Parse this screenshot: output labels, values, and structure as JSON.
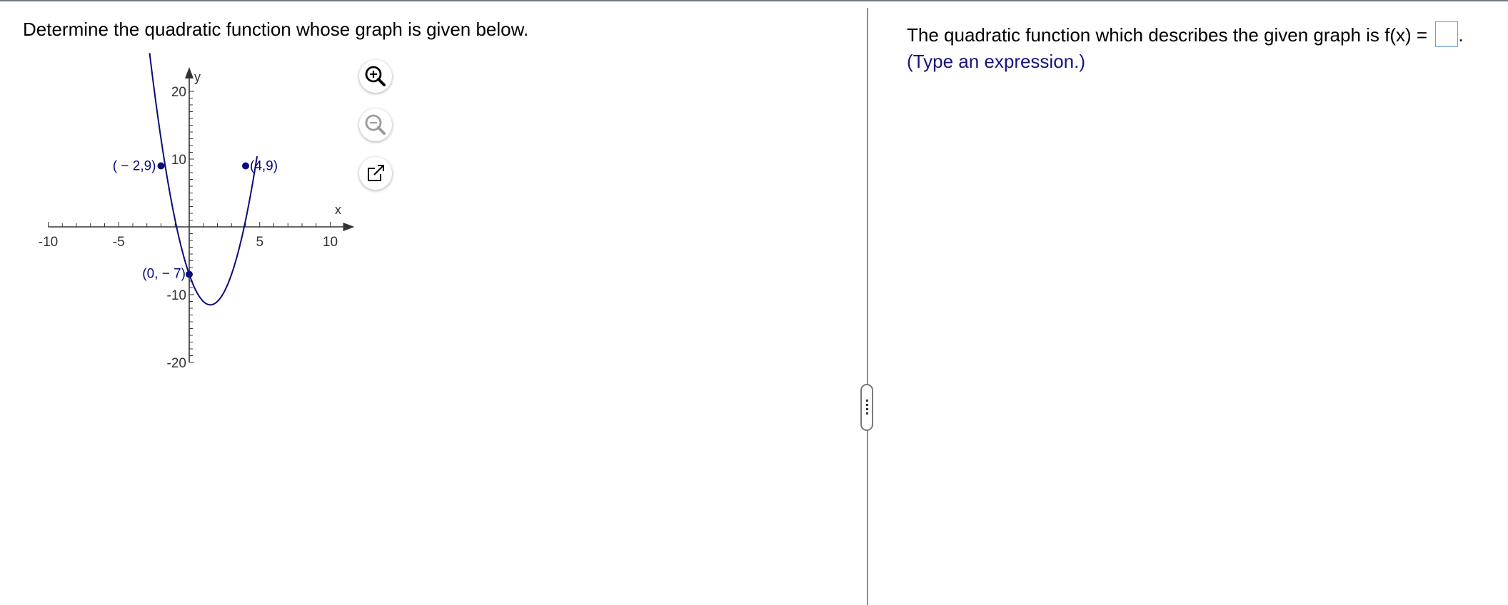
{
  "question": {
    "prompt": "Determine the quadratic function whose graph is given below."
  },
  "graph": {
    "axis_x_label": "x",
    "axis_y_label": "y",
    "x_tick_labels": [
      {
        "value": -10,
        "text": "-10"
      },
      {
        "value": -5,
        "text": "-5"
      },
      {
        "value": 5,
        "text": "5"
      },
      {
        "value": 10,
        "text": "10"
      }
    ],
    "y_tick_labels": [
      {
        "value": 20,
        "text": "20"
      },
      {
        "value": 10,
        "text": "10"
      },
      {
        "value": -10,
        "text": "-10"
      },
      {
        "value": -20,
        "text": "-20"
      }
    ],
    "curve_color": "#0b0b7a",
    "axis_color": "#333333"
  },
  "chart_data": {
    "type": "line",
    "xlim": [
      -10,
      10
    ],
    "ylim": [
      -20,
      20
    ],
    "x_ticks": [
      -10,
      -5,
      5,
      10
    ],
    "y_ticks": [
      -20,
      -10,
      10,
      20
    ],
    "minor_tick_step": 1,
    "xlabel": "x",
    "ylabel": "y",
    "grid": false,
    "curve": {
      "a": 2,
      "b": -6,
      "c": -7,
      "x_range": [
        -2.81,
        4.81
      ]
    },
    "points": [
      {
        "x": -2,
        "y": 9,
        "label": "( − 2,9)"
      },
      {
        "x": 4,
        "y": 9,
        "label": "(4,9)"
      },
      {
        "x": 0,
        "y": -7,
        "label": "(0, − 7)"
      }
    ]
  },
  "tools": {
    "zoom_in": "zoom-in",
    "zoom_out": "zoom-out",
    "open_window": "open-in-new-window"
  },
  "answer": {
    "statement": "The quadratic function which describes the given graph is f(x) = ",
    "input_value": "",
    "trailing": ".",
    "hint": "(Type an expression.)"
  }
}
